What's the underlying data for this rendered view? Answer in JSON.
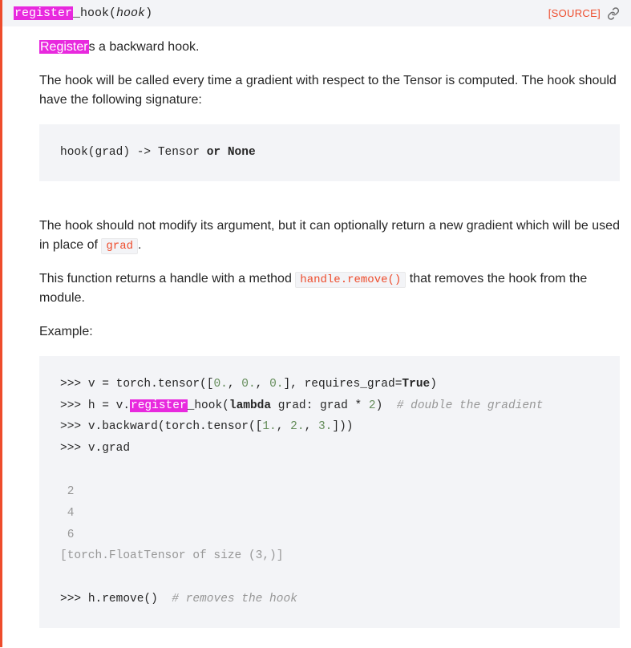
{
  "method": {
    "name_hl": "register",
    "name_rest": "_hook",
    "param": "hook",
    "source_label": "[SOURCE]"
  },
  "body": {
    "p1_hl": "Register",
    "p1_rest": "s a backward hook.",
    "p2": "The hook will be called every time a gradient with respect to the Tensor is computed. The hook should have the following signature:",
    "sig_code": {
      "pre": "hook(grad) -> Tensor ",
      "kw1": "or",
      "mid": " ",
      "kw2": "None"
    },
    "p3a": "The hook should not modify its argument, but it can optionally return a new gradient which will be used in place of ",
    "p3_code": "grad",
    "p3b": ".",
    "p4a": "This function returns a handle with a method ",
    "p4_code": "handle.remove()",
    "p4b": " that removes the hook from the module.",
    "p5": "Example:",
    "example": {
      "l1": {
        "prompt": ">>> ",
        "t1": "v = torch.tensor([",
        "n1": "0.",
        "t2": ", ",
        "n2": "0.",
        "t3": ", ",
        "n3": "0.",
        "t4": "], requires_grad=",
        "kw": "True",
        "t5": ")"
      },
      "l2": {
        "prompt": ">>> ",
        "t1": "h = v.",
        "hl": "register",
        "t2": "_hook(",
        "kw": "lambda",
        "t3": " grad: grad * ",
        "n1": "2",
        "t4": ")  ",
        "cmt": "# double the gradient"
      },
      "l3": {
        "prompt": ">>> ",
        "t1": "v.backward(torch.tensor([",
        "n1": "1.",
        "t2": ", ",
        "n2": "2.",
        "t3": ", ",
        "n3": "3.",
        "t4": "]))"
      },
      "l4": {
        "prompt": ">>> ",
        "t1": "v.grad"
      },
      "o1": " 2",
      "o2": " 4",
      "o3": " 6",
      "o4": "[torch.FloatTensor of size (3,)]",
      "l5": {
        "prompt": ">>> ",
        "t1": "h.remove()  ",
        "cmt": "# removes the hook"
      }
    }
  }
}
